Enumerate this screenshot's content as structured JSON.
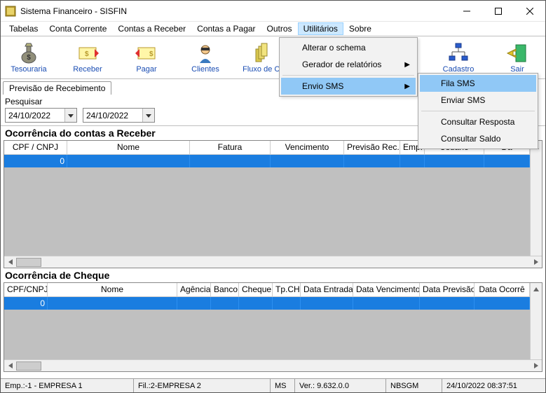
{
  "window": {
    "title": "Sistema Financeiro - SISFIN"
  },
  "menu": {
    "tabelas": "Tabelas",
    "conta_corrente": "Conta Corrente",
    "contas_receber": "Contas a Receber",
    "contas_pagar": "Contas a Pagar",
    "outros": "Outros",
    "utilitarios": "Utilitários",
    "sobre": "Sobre"
  },
  "toolbar": {
    "tesouraria": "Tesouraria",
    "receber": "Receber",
    "pagar": "Pagar",
    "clientes": "Clientes",
    "fluxo": "Fluxo de Cai",
    "cadastro": "Cadastro",
    "sair": "Sair"
  },
  "tab": {
    "previsao_recebimento": "Previsão de Recebimento"
  },
  "search": {
    "label": "Pesquisar",
    "date_from": "24/10/2022",
    "date_to": "24/10/2022"
  },
  "section1": {
    "title": "Ocorrência do contas a Receber",
    "cols": {
      "cpf": "CPF / CNPJ",
      "nome": "Nome",
      "fatura": "Fatura",
      "venc": "Vencimento",
      "prev": "Previsão Rec.",
      "emp": "Emp.",
      "usuario": "Usuário",
      "da": "Da"
    },
    "row0_col0": "0"
  },
  "section2": {
    "title": "Ocorrência de Cheque",
    "cols": {
      "cpf": "CPF/CNPJ",
      "nome": "Nome",
      "agencia": "Agência",
      "banco": "Banco",
      "cheque": "Cheque",
      "tpch": "Tp.CH",
      "data_entrada": "Data Entrada",
      "data_venc": "Data Vencimento",
      "data_prev": "Data Previsão",
      "data_ocorre": "Data Ocorrê"
    },
    "row0_col0": "0"
  },
  "status": {
    "emp": "Emp.:-1 - EMPRESA 1",
    "fil": "Fil.:2-EMPRESA 2",
    "ms": "MS",
    "ver": "Ver.: 9.632.0.0",
    "user": "NBSGM",
    "dt": "24/10/2022 08:37:51"
  },
  "dd1": {
    "alterar": "Alterar o schema",
    "gerador": "Gerador de relatórios",
    "envio_sms": "Envio SMS"
  },
  "dd2": {
    "fila": "Fila SMS",
    "enviar": "Enviar SMS",
    "resposta": "Consultar Resposta",
    "saldo": "Consultar Saldo"
  }
}
